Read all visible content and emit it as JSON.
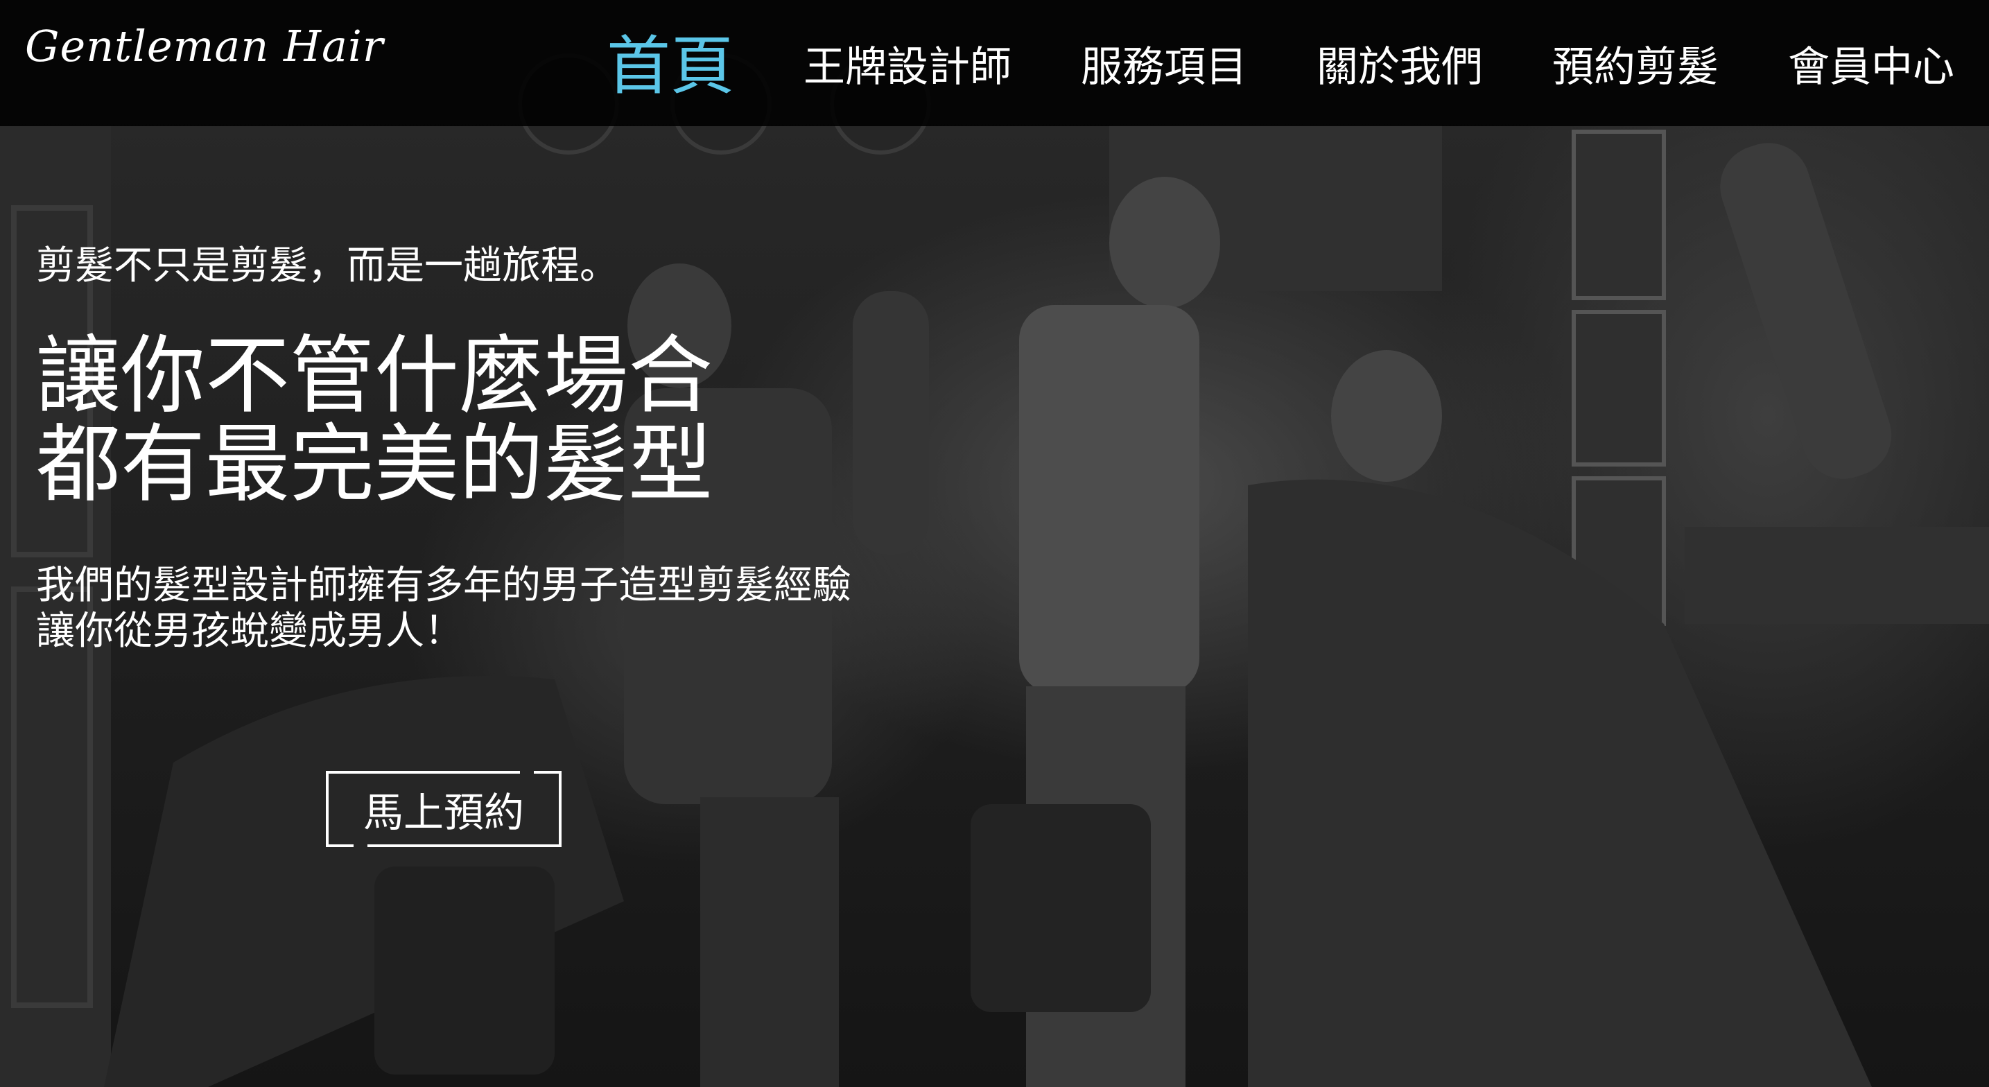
{
  "brand": {
    "logo_text": "Gentleman Hair"
  },
  "nav": {
    "items": [
      {
        "label": "首頁",
        "active": true
      },
      {
        "label": "王牌設計師",
        "active": false
      },
      {
        "label": "服務項目",
        "active": false
      },
      {
        "label": "關於我們",
        "active": false
      },
      {
        "label": "預約剪髮",
        "active": false
      },
      {
        "label": "會員中心",
        "active": false
      }
    ]
  },
  "hero": {
    "tagline": "剪髮不只是剪髮，而是一趟旅程。",
    "headline_line1": "讓你不管什麼場合",
    "headline_line2": "都有最完美的髮型",
    "description_line1": "我們的髮型設計師擁有多年的男子造型剪髮經驗",
    "description_line2": "讓你從男孩蛻變成男人！",
    "cta_label": "馬上預約",
    "background_image": "black-and-white-barbershop-photo"
  },
  "colors": {
    "accent": "#5bc6e8",
    "nav_bg": "#000000",
    "text": "#ffffff"
  }
}
